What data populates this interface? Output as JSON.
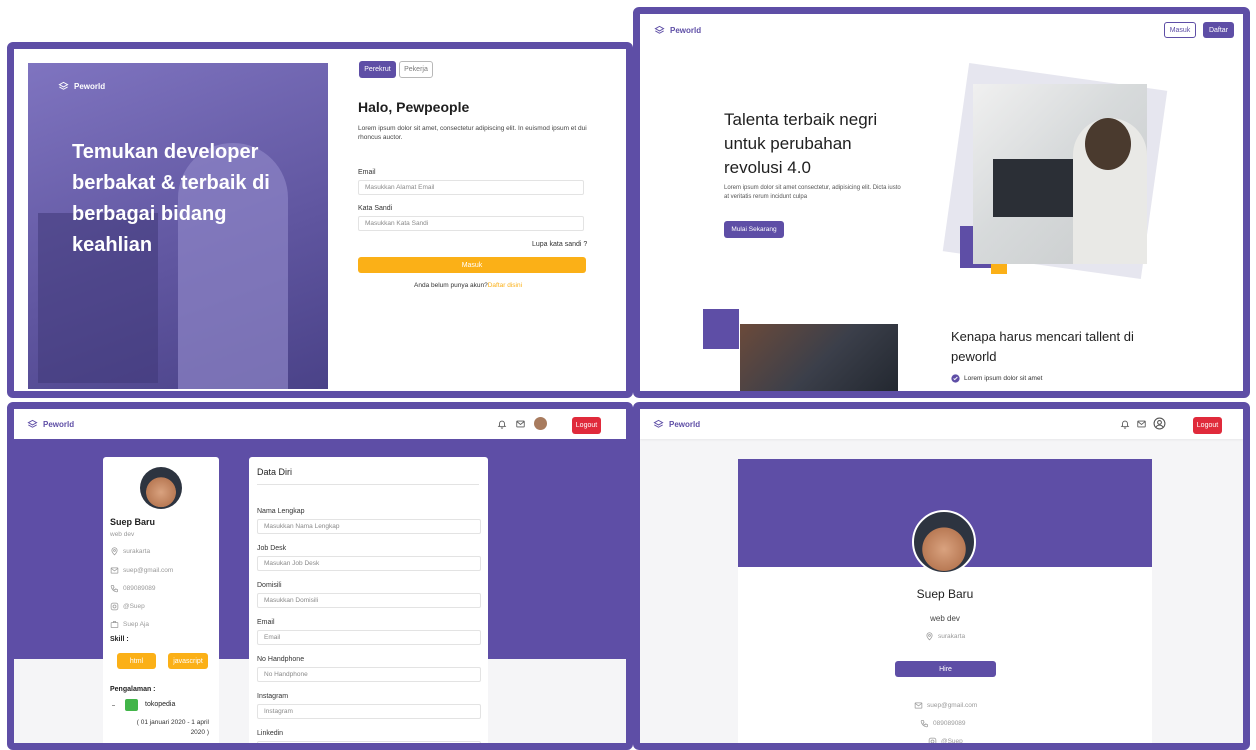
{
  "brand": "Peworld",
  "colors": {
    "primary": "#5e4ea6",
    "accent": "#fbb017",
    "danger": "#e02a3b"
  },
  "login": {
    "hero_text": "Temukan developer berbakat & terbaik di berbagai bidang keahlian",
    "role_tabs": [
      "Perekrut",
      "Pekerja"
    ],
    "title": "Halo, Pewpeople",
    "description": "Lorem ipsum dolor sit amet, consectetur adipiscing elit. In euismod ipsum et dui rhoncus auctor.",
    "email_label": "Email",
    "email_placeholder": "Masukkan Alamat Email",
    "password_label": "Kata Sandi",
    "password_placeholder": "Masukkan Kata Sandi",
    "forgot": "Lupa kata sandi ?",
    "submit": "Masuk",
    "no_account": "Anda belum punya akun?",
    "register_link": "Daftar disini"
  },
  "landing": {
    "nav_login": "Masuk",
    "nav_register": "Daftar",
    "headline": "Talenta terbaik negri untuk perubahan revolusi 4.0",
    "subtext": "Lorem ipsum dolor sit amet consectetur, adipisicing elit. Dicta iusto at veritatis rerum incidunt culpa",
    "cta": "Mulai Sekarang",
    "section_title": "Kenapa harus mencari tallent di peworld",
    "check_item": "Lorem ipsum dolor sit amet"
  },
  "edit_profile": {
    "logout": "Logout",
    "name": "Suep Baru",
    "job": "web dev",
    "location": "surakarta",
    "email": "suep@gmail.com",
    "phone": "089089089",
    "instagram": "@Suep",
    "company": "Suep Aja",
    "skill_label": "Skill :",
    "skills": [
      "html",
      "javascript"
    ],
    "experience_label": "Pengalaman :",
    "experience_company": "tokopedia",
    "experience_period": "( 01 januari 2020 - 1 april 2020 )",
    "form_title": "Data Diri",
    "fields": [
      {
        "label": "Nama Lengkap",
        "placeholder": "Masukkan Nama Lengkap"
      },
      {
        "label": "Job Desk",
        "placeholder": "Masukan Job Desk"
      },
      {
        "label": "Domisili",
        "placeholder": "Masukkan Domisili"
      },
      {
        "label": "Email",
        "placeholder": "Email"
      },
      {
        "label": "No Handphone",
        "placeholder": "No Handphone"
      },
      {
        "label": "Instagram",
        "placeholder": "Instagram"
      },
      {
        "label": "Linkedin",
        "placeholder": ""
      }
    ]
  },
  "public_profile": {
    "logout": "Logout",
    "name": "Suep Baru",
    "job": "web dev",
    "location": "surakarta",
    "hire": "Hire",
    "email": "suep@gmail.com",
    "phone": "089089089",
    "instagram": "@Suep"
  },
  "icons": [
    "layers-logo-icon",
    "bell-icon",
    "mail-icon",
    "user-icon",
    "location-pin-icon",
    "phone-icon",
    "instagram-icon",
    "briefcase-icon",
    "check-circle-icon"
  ]
}
